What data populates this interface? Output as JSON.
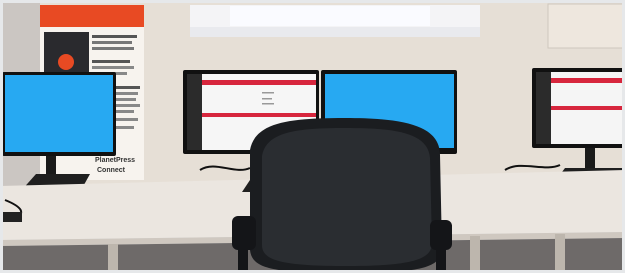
{
  "scene": {
    "description_text_visible": {
      "banner_heading": "PlanetPress",
      "banner_subheading": "Connect"
    }
  },
  "palette": {
    "wall": "#e7ddd2",
    "desk": "#eae5df",
    "floor": "#6f6b6a",
    "screen_blue": "#27a9f2",
    "brand_red": "#d7263d",
    "chair": "#1d1f22"
  }
}
